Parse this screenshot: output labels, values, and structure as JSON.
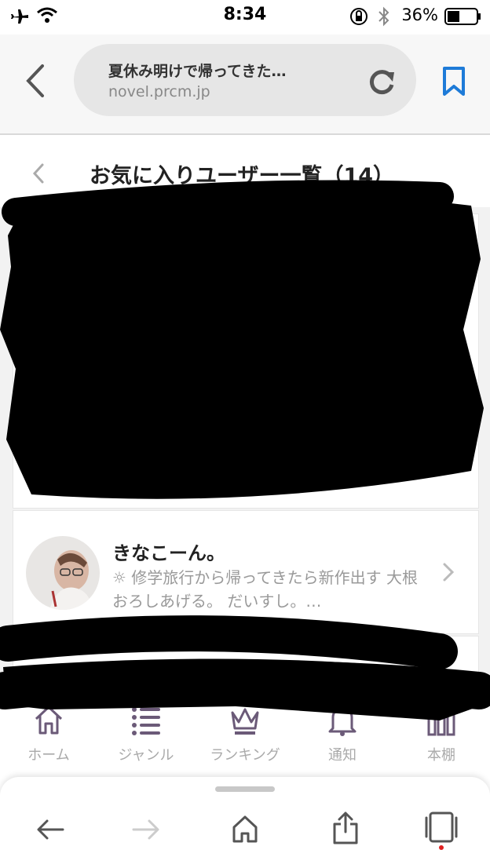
{
  "status_bar": {
    "time": "8:34",
    "battery_percent": "36%",
    "icons": [
      "airplane-icon",
      "wifi-icon",
      "orientation-lock-icon",
      "bluetooth-icon",
      "battery-icon"
    ]
  },
  "browser": {
    "page_title": "夏休み明けで帰ってきた…",
    "domain": "novel.prcm.jp"
  },
  "page": {
    "title": "お気に入りユーザー一覧（14）"
  },
  "users": [
    {
      "name": "きなこーん。",
      "description": "☼ 修学旅行から帰ってきたら新作出す 大根おろしあげる。 だいすし。…"
    }
  ],
  "tabbar": {
    "tabs": [
      {
        "label": "ホーム",
        "icon": "home-icon"
      },
      {
        "label": "ジャンル",
        "icon": "list-icon"
      },
      {
        "label": "ランキング",
        "icon": "crown-icon"
      },
      {
        "label": "通知",
        "icon": "bell-icon"
      },
      {
        "label": "本棚",
        "icon": "bookshelf-icon"
      }
    ]
  },
  "colors": {
    "accent_blue": "#1e7bd8",
    "icon_purple": "#6b5a78",
    "tab_label_gray": "#aaaaaa"
  }
}
